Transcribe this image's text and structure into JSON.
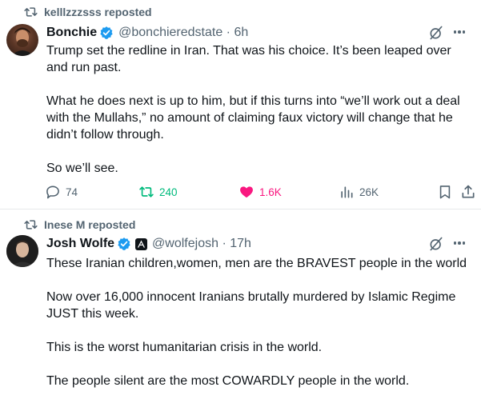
{
  "tweets": [
    {
      "reposted_by": "kelllzzzsss reposted",
      "name": "Bonchie",
      "handle_time": "@bonchieredstate · 6h",
      "paragraphs": [
        "Trump set the redline in Iran. That was his choice. It’s been leaped over and run past.",
        "What he does next is up to him, but if this turns into “we’ll work out a deal with the Mullahs,” no amount of claiming faux victory will change that he didn’t follow through.",
        "So we’ll see."
      ],
      "stats": {
        "replies": "74",
        "reposts": "240",
        "likes": "1.6K",
        "views": "26K"
      }
    },
    {
      "reposted_by": "Inese M reposted",
      "name": "Josh Wolfe",
      "handle_time": "@wolfejosh · 17h",
      "paragraphs": [
        "These Iranian children,women, men are the BRAVEST people in the world",
        "Now over 16,000 innocent Iranians brutally murdered by Islamic Regime JUST this week.",
        "This is the worst humanitarian crisis in the world.",
        "The people silent are the most COWARDLY people in the world."
      ]
    }
  ],
  "colors": {
    "text": "#0f1419",
    "secondary": "#536471",
    "verified": "#1d9bf0",
    "repost_green": "#00ba7c",
    "like_pink": "#f91880",
    "divider": "#e6e9eb"
  },
  "icons": [
    "repost-icon",
    "verified-badge-icon",
    "grok-icon",
    "more-icon",
    "reply-icon",
    "retweet-icon",
    "heart-icon",
    "views-icon",
    "bookmark-icon",
    "share-icon"
  ]
}
